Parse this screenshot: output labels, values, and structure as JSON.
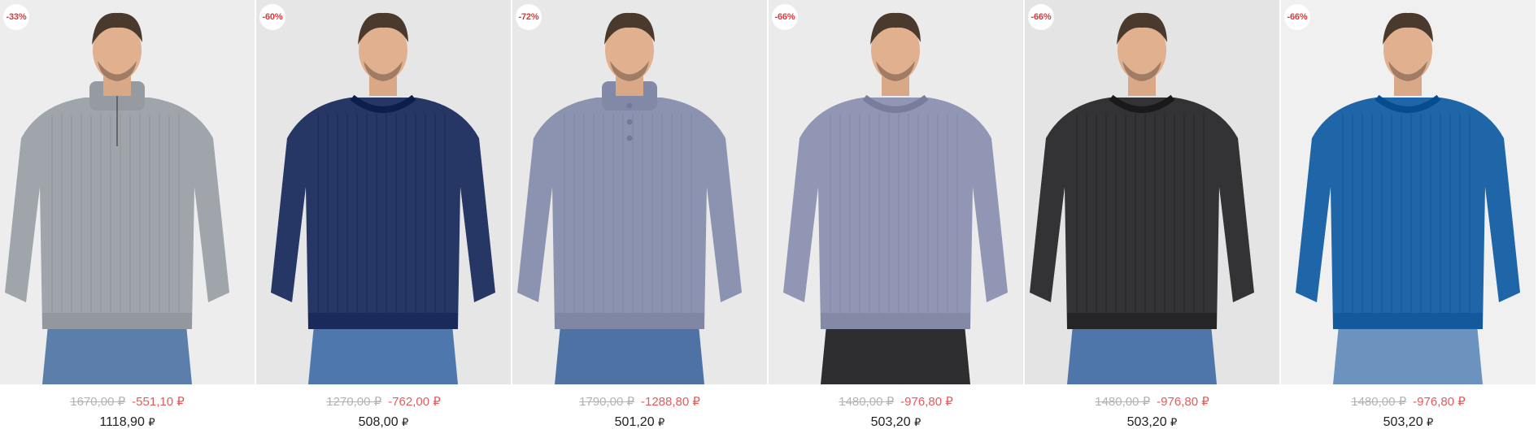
{
  "products": [
    {
      "badge": "-33%",
      "old_price": "1670,00 ₽",
      "discount": "-551,10 ₽",
      "price": "1118,90",
      "currency": "₽",
      "bg": "#ededed",
      "sweater": "#9fa5ab",
      "jeans": "#5b7faa",
      "collar": "zip-neck",
      "pattern": "cable-knit"
    },
    {
      "badge": "-60%",
      "old_price": "1270,00 ₽",
      "discount": "-762,00 ₽",
      "price": "508,00",
      "currency": "₽",
      "bg": "#e6e6e6",
      "sweater": "#263766",
      "jeans": "#4e78ad",
      "collar": "crew-neck",
      "pattern": "melange"
    },
    {
      "badge": "-72%",
      "old_price": "1790,00 ₽",
      "discount": "-1288,80 ₽",
      "price": "501,20",
      "currency": "₽",
      "bg": "#e8e8e8",
      "sweater": "#8c93b0",
      "jeans": "#4e72a3",
      "collar": "button-neck",
      "pattern": "waffle-knit"
    },
    {
      "badge": "-66%",
      "old_price": "1480,00 ₽",
      "discount": "-976,80 ₽",
      "price": "503,20",
      "currency": "₽",
      "bg": "#ebebeb",
      "sweater": "#9096b3",
      "jeans": "#2e2e30",
      "collar": "crew-neck",
      "pattern": "rib-knit"
    },
    {
      "badge": "-66%",
      "old_price": "1480,00 ₽",
      "discount": "-976,80 ₽",
      "price": "503,20",
      "currency": "₽",
      "bg": "#e4e4e4",
      "sweater": "#333335",
      "jeans": "#4f76ab",
      "collar": "crew-neck",
      "pattern": "rib-knit"
    },
    {
      "badge": "-66%",
      "old_price": "1480,00 ₽",
      "discount": "-976,80 ₽",
      "price": "503,20",
      "currency": "₽",
      "bg": "#f0f0f0",
      "sweater": "#1f66a8",
      "jeans": "#6b93bd",
      "collar": "crew-neck",
      "pattern": "cable-knit"
    }
  ]
}
